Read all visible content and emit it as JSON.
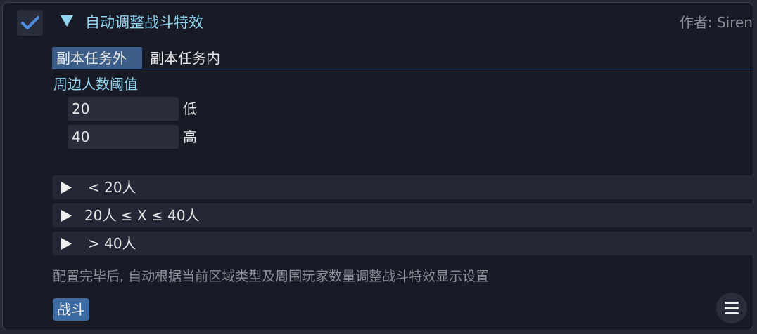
{
  "header": {
    "title": "自动调整战斗特效",
    "author": "作者: Siren",
    "enabled": true
  },
  "tabs": [
    {
      "label": "副本任务外",
      "active": true
    },
    {
      "label": "副本任务内",
      "active": false
    }
  ],
  "threshold": {
    "label": "周边人数阈值",
    "low": {
      "value": "20",
      "unit": "低"
    },
    "high": {
      "value": "40",
      "unit": "高"
    }
  },
  "ranges": [
    {
      "label": "<  20人"
    },
    {
      "label": "20人 ≤ X ≤ 40人"
    },
    {
      "label": ">  40人"
    }
  ],
  "description": "配置完毕后, 自动根据当前区域类型及周围玩家数量调整战斗特效显示设置",
  "tag": "战斗",
  "colors": {
    "accent": "#8fd4f0",
    "tab_active": "#3c5d87",
    "tag": "#3c6aa3",
    "panel": "#181b25",
    "check": "#4f8fe0"
  },
  "icons": {
    "checkbox": "check-icon",
    "collapse": "triangle-down-icon",
    "expand": "triangle-right-icon",
    "menu": "hamburger-icon"
  }
}
